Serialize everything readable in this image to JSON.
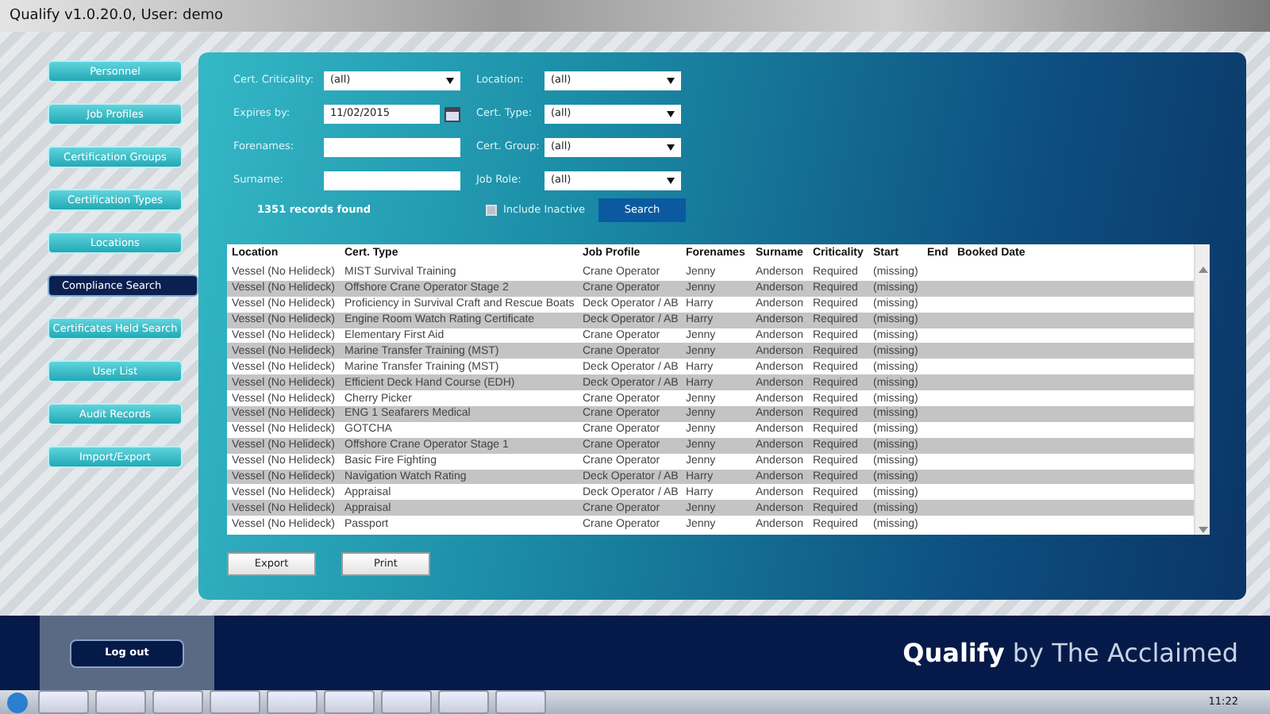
{
  "window": {
    "title": "Qualify v1.0.20.0, User: demo"
  },
  "sidebar": {
    "items": [
      {
        "label": "Personnel",
        "selected": false
      },
      {
        "label": "Job Profiles",
        "selected": false
      },
      {
        "label": "Certification Groups",
        "selected": false
      },
      {
        "label": "Certification Types",
        "selected": false
      },
      {
        "label": "Locations",
        "selected": false
      },
      {
        "label": "Compliance Search",
        "selected": true
      },
      {
        "label": "Certificates Held Search",
        "selected": false
      },
      {
        "label": "User List",
        "selected": false
      },
      {
        "label": "Audit Records",
        "selected": false
      },
      {
        "label": "Import/Export",
        "selected": false
      }
    ],
    "logout": "Log out"
  },
  "filters": {
    "left": [
      {
        "label": "Cert. Criticality:",
        "kind": "dropdown",
        "value": "(all)"
      },
      {
        "label": "Expires by:",
        "kind": "date",
        "value": "11/02/2015"
      },
      {
        "label": "Forenames:",
        "kind": "text"
      },
      {
        "label": "Surname:",
        "kind": "text"
      }
    ],
    "right": [
      {
        "label": "Location:",
        "kind": "dropdown",
        "value": "(all)"
      },
      {
        "label": "Cert. Type:",
        "kind": "dropdown",
        "value": "(all)"
      },
      {
        "label": "Cert. Group:",
        "kind": "dropdown",
        "value": "(all)"
      },
      {
        "label": "Job Role:",
        "kind": "dropdown",
        "value": "(all)"
      }
    ],
    "records_found": "1351 records found",
    "include_inactive": {
      "label": "Include Inactive",
      "checked": false
    },
    "search_button": "Search"
  },
  "table": {
    "columns": [
      "Location",
      "Cert. Type",
      "Job Profile",
      "Forenames",
      "Surname",
      "Criticality",
      "Start",
      "End",
      "Booked Date"
    ],
    "rows": [
      [
        "Vessel (No Helideck)",
        "MIST Survival Training",
        "Crane Operator",
        "Jenny",
        "Anderson",
        "Required",
        "(missing)"
      ],
      [
        "Vessel (No Helideck)",
        "Offshore Crane Operator Stage 2",
        "Crane Operator",
        "Jenny",
        "Anderson",
        "Required",
        "(missing)"
      ],
      [
        "Vessel (No Helideck)",
        "Proficiency in Survival Craft and Rescue Boats",
        "Deck Operator / AB",
        "Harry",
        "Anderson",
        "Required",
        "(missing)"
      ],
      [
        "Vessel (No Helideck)",
        "Engine Room Watch Rating Certificate",
        "Deck Operator / AB",
        "Harry",
        "Anderson",
        "Required",
        "(missing)"
      ],
      [
        "Vessel (No Helideck)",
        "Elementary First Aid",
        "Crane Operator",
        "Jenny",
        "Anderson",
        "Required",
        "(missing)"
      ],
      [
        "Vessel (No Helideck)",
        "Marine Transfer Training (MST)",
        "Crane Operator",
        "Jenny",
        "Anderson",
        "Required",
        "(missing)"
      ],
      [
        "Vessel (No Helideck)",
        "Marine Transfer Training (MST)",
        "Deck Operator / AB",
        "Harry",
        "Anderson",
        "Required",
        "(missing)"
      ],
      [
        "Vessel (No Helideck)",
        "Efficient Deck Hand Course (EDH)",
        "Deck Operator / AB",
        "Harry",
        "Anderson",
        "Required",
        "(missing)"
      ],
      [
        "Vessel (No Helideck)",
        "Cherry Picker",
        "Crane Operator",
        "Jenny",
        "Anderson",
        "Required",
        "(missing)"
      ],
      [
        "Vessel (No Helideck)",
        "ENG 1 Seafarers Medical",
        "Crane Operator",
        "Jenny",
        "Anderson",
        "Required",
        "(missing)"
      ],
      [
        "Vessel (No Helideck)",
        "GOTCHA",
        "Crane Operator",
        "Jenny",
        "Anderson",
        "Required",
        "(missing)"
      ],
      [
        "Vessel (No Helideck)",
        "Offshore Crane Operator Stage 1",
        "Crane Operator",
        "Jenny",
        "Anderson",
        "Required",
        "(missing)"
      ],
      [
        "Vessel (No Helideck)",
        "Basic Fire Fighting",
        "Crane Operator",
        "Jenny",
        "Anderson",
        "Required",
        "(missing)"
      ],
      [
        "Vessel (No Helideck)",
        "Navigation Watch Rating",
        "Deck Operator / AB",
        "Harry",
        "Anderson",
        "Required",
        "(missing)"
      ],
      [
        "Vessel (No Helideck)",
        "Appraisal",
        "Deck Operator / AB",
        "Harry",
        "Anderson",
        "Required",
        "(missing)"
      ],
      [
        "Vessel (No Helideck)",
        "Appraisal",
        "Crane Operator",
        "Jenny",
        "Anderson",
        "Required",
        "(missing)"
      ],
      [
        "Vessel (No Helideck)",
        "Passport",
        "Crane Operator",
        "Jenny",
        "Anderson",
        "Required",
        "(missing)"
      ]
    ]
  },
  "actions": [
    "Export",
    "Print"
  ],
  "brand": "**Qualify** by The Acclaimed",
  "taskbar": {
    "clock": "11:22"
  }
}
